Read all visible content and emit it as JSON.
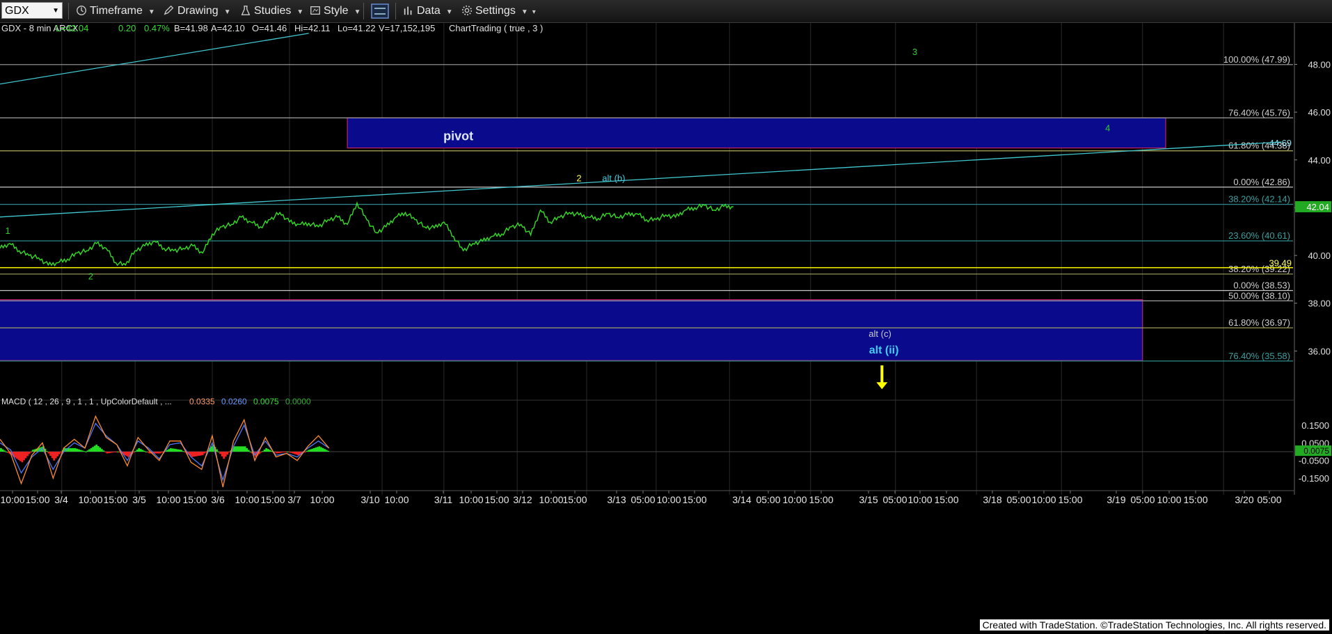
{
  "toolbar": {
    "symbol": "GDX",
    "timeframe": "Timeframe",
    "drawing": "Drawing",
    "studies": "Studies",
    "style": "Style",
    "data": "Data",
    "settings": "Settings"
  },
  "header": {
    "symbol_info": "GDX - 8 min  ARCX",
    "last": "L=42.04",
    "change": "0.20",
    "change_pct": "0.47%",
    "bid": "B=41.98",
    "ask": "A=42.10",
    "open": "O=41.46",
    "high": "Hi=42.11",
    "low": "Lo=41.22",
    "volume": "V=17,152,195",
    "study": "ChartTrading ( true , 3 )"
  },
  "macd_header": {
    "label": "MACD ( 12 , 26 , 9 , 1 , 1 , UpColorDefault , ...",
    "v1": "0.0335",
    "v2": "0.0260",
    "v3": "0.0075",
    "v4": "0.0000"
  },
  "footer": "Created with TradeStation. ©TradeStation Technologies, Inc. All rights reserved.",
  "colors": {
    "price": "#33dd22",
    "macd": "#ff8c2a",
    "signal": "#4a78ff",
    "hist_up": "#22dd22",
    "hist_down": "#ee2222",
    "zone_fill": "#0a0a8c",
    "zone_border": "#c0206a",
    "trend": "#40c8d0",
    "yellow": "#ffff00"
  },
  "chart_data": {
    "type": "line",
    "title": "GDX - 8 min",
    "ylim": [
      34.0,
      49.5
    ],
    "y_ticks": [
      36.0,
      38.0,
      40.0,
      42.0,
      44.0,
      46.0,
      48.0
    ],
    "last_price": 42.04,
    "last_price_label": "42.04",
    "x_tick_labels": [
      "10:00",
      "15:00",
      "3/4",
      "10:00",
      "15:00",
      "3/5",
      "10:00",
      "15:00",
      "3/6",
      "10:00",
      "15:00",
      "3/7",
      "10:00",
      "3/10",
      "10:00",
      "3/11",
      "10:00",
      "15:00",
      "3/12",
      "10:00",
      "15:00",
      "3/13",
      "05:00",
      "10:00",
      "15:00",
      "3/14",
      "05:00",
      "10:00",
      "15:00",
      "3/15",
      "05:00",
      "10:00",
      "15:00",
      "3/18",
      "05:00",
      "10:00",
      "15:00",
      "3/19",
      "05:00",
      "10:00",
      "15:00",
      "3/20",
      "05:00"
    ],
    "price_series": {
      "name": "GDX",
      "x": [
        0,
        0.25,
        0.5,
        0.75,
        1.0,
        1.25,
        1.5,
        1.75,
        2.0,
        2.25,
        2.5,
        2.75,
        3.0,
        3.25,
        3.5,
        3.75,
        4.0,
        4.25,
        4.5,
        4.75,
        5.0,
        5.25,
        5.5,
        5.75,
        6.0,
        6.25,
        6.5,
        6.75,
        7.0,
        7.25,
        7.5,
        7.75,
        8.0,
        8.25,
        8.5,
        8.75,
        9.0,
        9.25,
        9.5,
        9.75,
        10.0,
        10.25,
        10.5,
        10.75,
        11.0,
        11.25,
        11.5,
        11.75,
        12.0,
        12.25,
        12.5,
        12.75,
        13.0,
        13.25,
        13.5,
        13.75,
        14.0,
        14.25,
        14.5,
        14.75,
        15.0,
        15.25,
        15.5,
        15.75,
        16.0,
        16.25,
        16.5,
        16.75,
        17.0,
        17.25,
        17.5,
        17.75,
        18.0,
        18.25,
        18.5,
        18.75,
        19.0
      ],
      "y": [
        40.3,
        40.5,
        40.2,
        40.0,
        39.9,
        39.6,
        39.7,
        39.85,
        40.1,
        40.2,
        40.5,
        40.3,
        39.7,
        39.6,
        40.2,
        40.4,
        40.6,
        40.3,
        40.2,
        40.3,
        40.4,
        40.1,
        40.9,
        41.2,
        41.3,
        41.6,
        41.4,
        41.2,
        41.5,
        41.8,
        41.4,
        41.3,
        41.35,
        41.2,
        41.5,
        41.6,
        41.3,
        42.2,
        41.5,
        40.95,
        41.2,
        41.6,
        41.8,
        41.5,
        41.2,
        41.15,
        41.4,
        40.8,
        40.2,
        40.5,
        40.6,
        40.8,
        40.9,
        41.2,
        41.3,
        40.85,
        41.9,
        41.4,
        41.6,
        41.8,
        41.7,
        41.6,
        41.55,
        41.75,
        41.6,
        41.7,
        41.75,
        41.5,
        41.5,
        41.7,
        41.6,
        41.9,
        42.0,
        42.1,
        41.9,
        42.05,
        42.04
      ]
    },
    "levels": [
      {
        "label": "100.00% (47.99)",
        "value": 47.99,
        "color": "#a0a0a0"
      },
      {
        "label": "76.40% (45.76)",
        "value": 45.76,
        "color": "#a0a0a0"
      },
      {
        "label": "61.80% (44.38)",
        "value": 44.38,
        "color": "#b0b060"
      },
      {
        "label": "0.00% (42.86)",
        "value": 42.86,
        "color": "#c8c8c8"
      },
      {
        "label": "38.20% (42.14)",
        "value": 42.14,
        "color": "#2e8a8a"
      },
      {
        "label": "23.60% (40.61)",
        "value": 40.61,
        "color": "#2e8a8a"
      },
      {
        "label": "38.20% (39.22)",
        "value": 39.22,
        "color": "#a0a060"
      },
      {
        "label": "0.00% (38.53)",
        "value": 38.53,
        "color": "#c8c8c8"
      },
      {
        "label": "50.00% (38.10)",
        "value": 38.1,
        "color": "#a0a0a0"
      },
      {
        "label": "61.80% (36.97)",
        "value": 36.97,
        "color": "#b0b060"
      },
      {
        "label": "76.40% (35.58)",
        "value": 35.58,
        "color": "#2e8a8a"
      }
    ],
    "yellow_line": {
      "value": 39.49,
      "label": "39.49"
    },
    "other_line": {
      "value": 44.69,
      "label": "44.69"
    },
    "zones": [
      {
        "name": "pivot",
        "label": "pivot",
        "y_top": 45.76,
        "y_bottom": 44.5,
        "x_start": 9.0,
        "x_end": 30.2
      },
      {
        "name": "support",
        "label": "",
        "y_top": 38.15,
        "y_bottom": 35.6,
        "x_start": -1,
        "x_end": 29.6
      }
    ],
    "trendlines": [
      {
        "x1": -0.1,
        "y1": 47.15,
        "x2": 8.0,
        "y2": 49.3
      },
      {
        "x1": -0.1,
        "y1": 41.6,
        "x2": 33.2,
        "y2": 44.75
      }
    ],
    "annotations": [
      {
        "text": "3",
        "x": 23.7,
        "y": 48.4,
        "color": "#33cc33"
      },
      {
        "text": "4",
        "x": 28.7,
        "y": 45.2,
        "color": "#33cc33"
      },
      {
        "text": "2",
        "x": 15.0,
        "y": 43.1,
        "color": "#ffff44"
      },
      {
        "text": "alt (b)",
        "x": 15.9,
        "y": 43.1,
        "color": "#44ccdd"
      },
      {
        "text": "1",
        "x": 0.2,
        "y": 40.9,
        "color": "#33cc33"
      },
      {
        "text": "2",
        "x": 2.35,
        "y": 39.0,
        "color": "#33cc33"
      },
      {
        "text": "alt (c)",
        "x": 22.8,
        "y": 36.6,
        "color": "#cccccc"
      },
      {
        "text": "alt (ii)",
        "x": 22.9,
        "y": 35.9,
        "color": "#44ccee"
      }
    ],
    "arrow": {
      "x": 22.85,
      "y_top": 35.4,
      "y_bottom": 34.4,
      "color": "#ffff00"
    },
    "macd": {
      "ylim": [
        -0.22,
        0.22
      ],
      "y_ticks": [
        -0.15,
        -0.05,
        0.05,
        0.15
      ],
      "y_tick_labels": [
        "-0.1500",
        "-0.0500",
        "0.0500",
        "0.1500"
      ],
      "last_label": "0.0075",
      "x": [
        0,
        0.5,
        1.0,
        1.5,
        2.0,
        2.5,
        3.0,
        3.5,
        4.0,
        4.5,
        5.0,
        5.5,
        6.0,
        6.5,
        7.0,
        7.5,
        8.0,
        8.5,
        9.0,
        9.5,
        10.0,
        10.5,
        11.0,
        11.5,
        12.0,
        12.5,
        13.0,
        13.5,
        14.0,
        14.5,
        15.0,
        15.5
      ],
      "macd_line": [
        0.07,
        -0.01,
        -0.18,
        -0.02,
        0.05,
        -0.15,
        0.02,
        0.07,
        0.02,
        0.2,
        0.08,
        0.04,
        -0.08,
        0.08,
        0.01,
        -0.05,
        0.06,
        0.06,
        -0.06,
        -0.1,
        0.09,
        -0.2,
        0.06,
        0.18,
        -0.05,
        0.08,
        -0.03,
        -0.01,
        -0.05,
        0.03,
        0.09,
        0.02
      ],
      "signal_line": [
        0.05,
        0.01,
        -0.12,
        -0.03,
        0.02,
        -0.1,
        0.0,
        0.05,
        0.02,
        0.16,
        0.09,
        0.04,
        -0.05,
        0.06,
        0.02,
        -0.04,
        0.04,
        0.05,
        -0.03,
        -0.08,
        0.05,
        -0.16,
        0.03,
        0.15,
        -0.02,
        0.06,
        -0.02,
        -0.01,
        -0.03,
        0.02,
        0.06,
        0.02
      ],
      "histogram": [
        0.02,
        -0.02,
        -0.06,
        0.01,
        0.03,
        -0.05,
        0.02,
        0.02,
        0.0,
        0.04,
        -0.01,
        0.0,
        -0.03,
        0.02,
        -0.01,
        -0.01,
        0.02,
        0.01,
        -0.03,
        -0.02,
        0.04,
        -0.04,
        0.03,
        0.03,
        -0.03,
        0.02,
        -0.01,
        0.0,
        -0.02,
        0.01,
        0.03,
        0.0
      ]
    }
  }
}
